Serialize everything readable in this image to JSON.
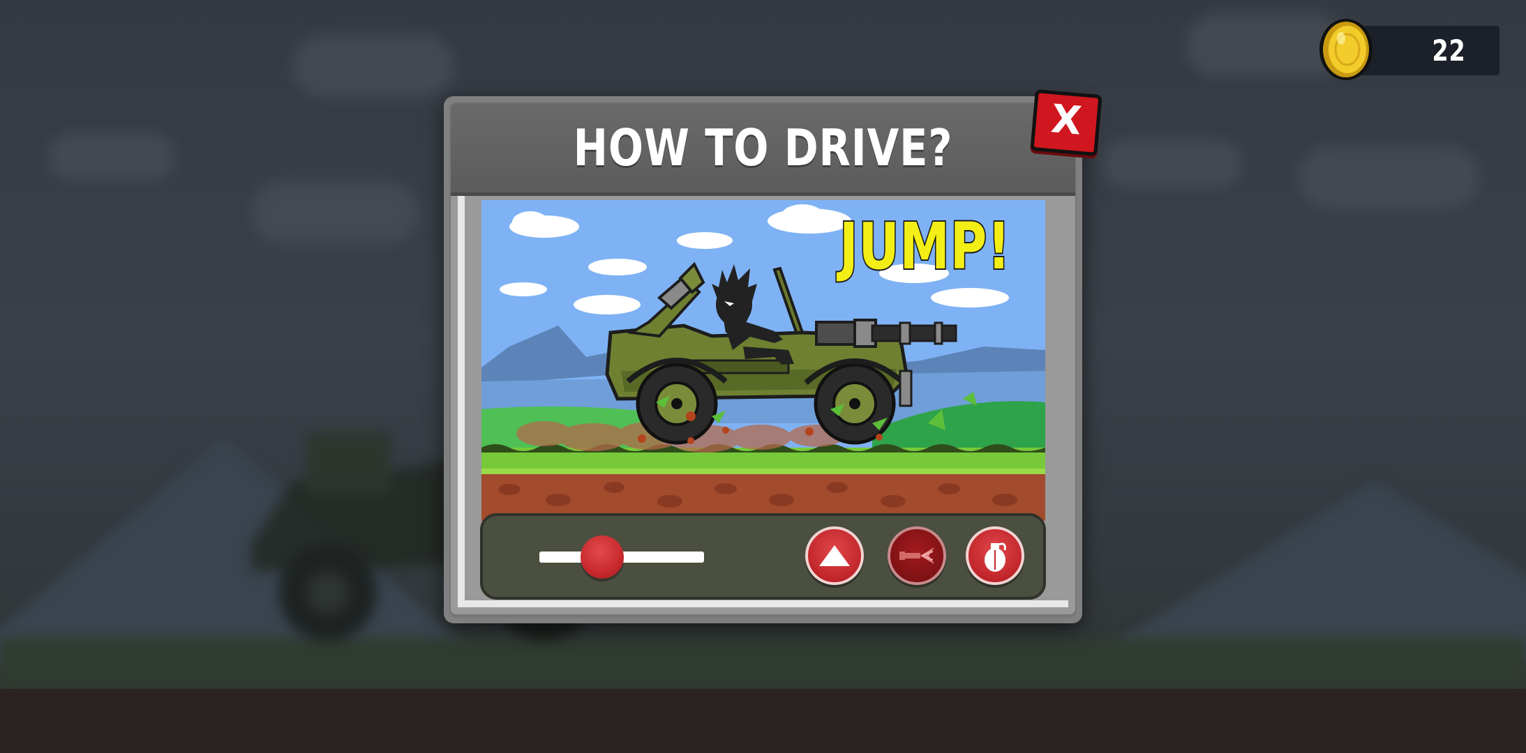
{
  "dialog": {
    "title": "HOW TO DRIVE?",
    "close_label": "X"
  },
  "tutorial": {
    "action_label": "JUMP!"
  },
  "hud": {
    "coin_count": "22"
  },
  "controls": {
    "throttle_slider_level": 0.38,
    "buttons": [
      "jump-button",
      "fire-button",
      "grenade-button"
    ]
  },
  "colors": {
    "close_button": "#d0161e",
    "jump_text": "#f3ef16",
    "control_button": "#c0252a",
    "control_bar": "#4a4f40",
    "dialog_frame": "#808080"
  },
  "icons": [
    "coin-icon",
    "close-icon",
    "arrow-up-icon",
    "gun-icon",
    "grenade-icon"
  ]
}
